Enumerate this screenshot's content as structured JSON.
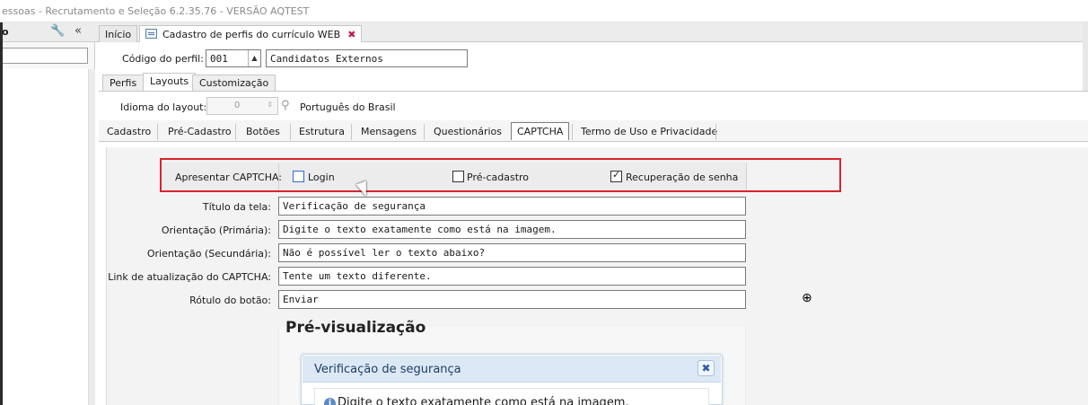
{
  "window": {
    "title": "essoas - Recrutamento e Seleção 6.2.35.76 - VERSÃO AQTEST"
  },
  "sidebar": {
    "header_fragment": "o",
    "wrench_icon": "wrench-icon",
    "collapse_glyph": "«"
  },
  "doc_tabs": [
    {
      "label": "Início"
    },
    {
      "label": "Cadastro de perfis do currículo WEB",
      "close_glyph": "✖"
    }
  ],
  "profile": {
    "code_label": "Código do perfil:",
    "code_value": "001",
    "name_value": "Candidatos Externos"
  },
  "sub_tabs": [
    "Perfis",
    "Layouts",
    "Customização"
  ],
  "language": {
    "label": "Idioma do layout:",
    "spin_value": "0",
    "name": "Português do Brasil"
  },
  "layout_tabs": [
    "Cadastro",
    "Pré-Cadastro",
    "Botões",
    "Estrutura",
    "Mensagens",
    "Questionários",
    "CAPTCHA",
    "Termo de Uso e Privacidade"
  ],
  "captcha": {
    "label": "Apresentar CAPTCHA:",
    "options": [
      {
        "label": "Login",
        "checked": false
      },
      {
        "label": "Pré-cadastro",
        "checked": false
      },
      {
        "label": "Recuperação de senha",
        "checked": true
      }
    ]
  },
  "fields": [
    {
      "label": "Título da tela:",
      "value": "Verificação de segurança"
    },
    {
      "label": "Orientação (Primária):",
      "value": "Digite o texto exatamente como está na imagem."
    },
    {
      "label": "Orientação (Secundária):",
      "value": "Não é possível ler o texto abaixo?"
    },
    {
      "label": "Link de atualização do CAPTCHA:",
      "value": "Tente um texto diferente."
    },
    {
      "label": "Rótulo do botão:",
      "value": "Enviar"
    }
  ],
  "preview": {
    "title": "Pré-visualização",
    "dialog_title": "Verificação de segurança",
    "close_glyph": "✖",
    "info_glyph": "i",
    "body_text": "Digite o texto exatamente como está na imagem."
  },
  "colors": {
    "highlight": "#d9242b",
    "dialog_header": "#dce8f5",
    "dialog_title": "#1c3f66"
  }
}
